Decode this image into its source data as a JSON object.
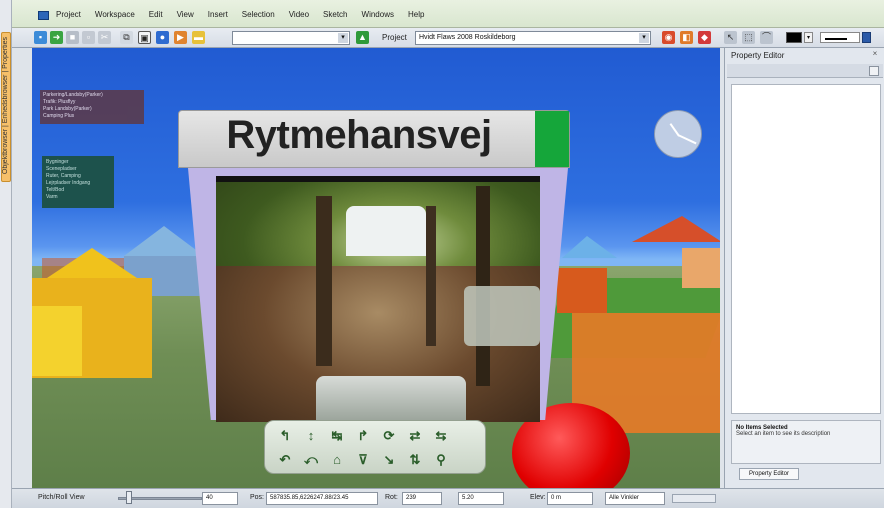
{
  "left_tab": {
    "label": "Objektbrowser | Enhedsbrowser | Properties"
  },
  "menu": {
    "items": [
      "Project",
      "Workspace",
      "Edit",
      "View",
      "Insert",
      "Selection",
      "Video",
      "Sketch",
      "Windows",
      "Help"
    ]
  },
  "toolbar": {
    "project_label": "Project",
    "project_value": "Hvidt Flaws 2008 Roskildeborg",
    "icons": [
      "new-icon",
      "open-icon",
      "save-icon",
      "print-icon",
      "cut-icon",
      "copy-icon",
      "paste-icon",
      "globe-icon",
      "arrow-icon",
      "folder-icon"
    ],
    "line_color": "#000000"
  },
  "viewport": {
    "info_box_1": [
      "Parkering/Landsby(Parker)",
      "Trafik: Plusflyy",
      "Park Landsby(Parker)",
      "Camping Plus"
    ],
    "info_box_2": [
      "Bygninger",
      "Scenepladser",
      "Ruter, Camping",
      "Lejrpladser Indgang",
      "Telt/Bod",
      "Varm"
    ],
    "street_sign": "Rytmehansvej",
    "sign_accent": "#15a63a",
    "ball_color": "#e00000"
  },
  "nav_controls": {
    "row1": [
      "↰",
      "↕",
      "↹",
      "↱",
      "⟳",
      "⇄",
      "⇆"
    ],
    "row2": [
      "↶",
      "⤺",
      "⌂",
      "⊽",
      "↘",
      "⇅",
      "⚲"
    ]
  },
  "property_editor": {
    "title": "Property Editor",
    "info_title": "No Items Selected",
    "info_desc": "Select an item to see its description",
    "tab_label": "Property Editor"
  },
  "statusbar": {
    "pitch_label": "Pitch/Roll View",
    "pitch_value": "40",
    "pos_label": "Pos:",
    "pos_value": "587835.85,6226247.88/23.45",
    "rot_label": "Rot:",
    "rot_value": "239",
    "scale_value": "5.20",
    "elev_label": "Elev:",
    "elev_value": "0 m",
    "mode_value": "Alle Vinkler"
  }
}
